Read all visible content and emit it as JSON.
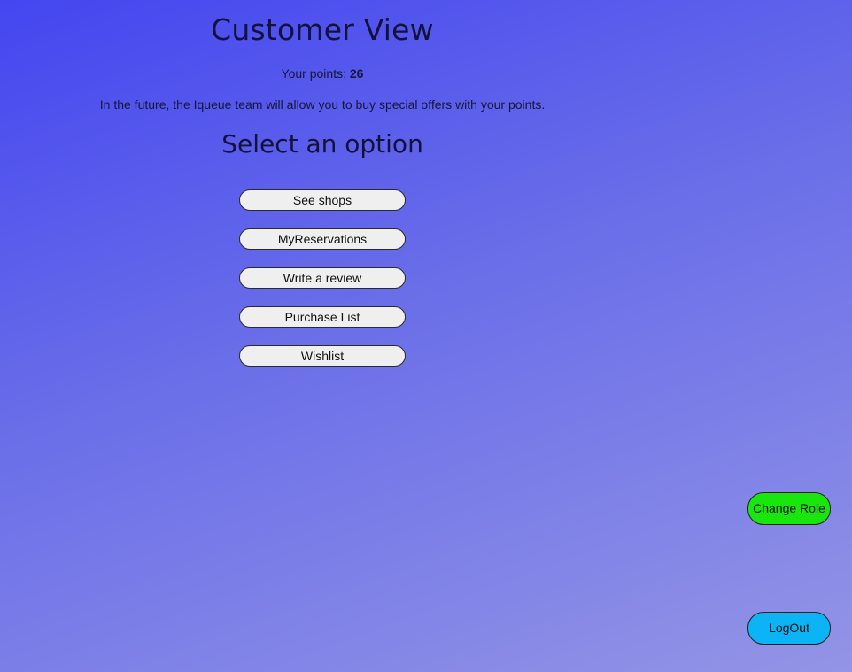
{
  "header": {
    "title": "Customer View"
  },
  "points": {
    "label": "Your points:",
    "value": "26"
  },
  "note": "In the future, the Iqueue team will allow you to buy special offers with your points.",
  "options": {
    "title": "Select an option",
    "items": [
      {
        "label": "See shops"
      },
      {
        "label": "MyReservations"
      },
      {
        "label": "Write a review"
      },
      {
        "label": "Purchase List"
      },
      {
        "label": "Wishlist"
      }
    ]
  },
  "actions": {
    "change_role": "Change Role",
    "logout": "LogOut"
  },
  "colors": {
    "background_start": "#4446f0",
    "background_end": "#9394e6",
    "change_role": "#19e60d",
    "logout": "#0db4f5",
    "option_button": "#efefef"
  }
}
